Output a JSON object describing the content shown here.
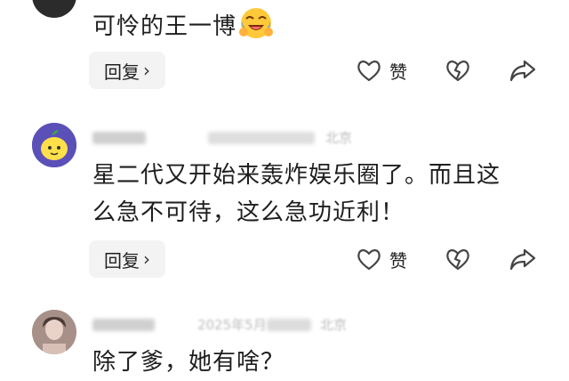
{
  "comments": [
    {
      "text": "可怜的王一博",
      "emoji": "laughing-crying-emoji",
      "reply_label": "回复",
      "like_label": "赞"
    },
    {
      "meta_partial_location": "北京",
      "text": "星二代又开始来轰炸娱乐圈了。而且这么急不可待，这么急功近利！",
      "reply_label": "回复",
      "like_label": "赞"
    },
    {
      "meta_partial_date": "2025年5月",
      "meta_partial_location": "北京",
      "text": "除了爹，她有啥？"
    }
  ],
  "icons": {
    "reply_chevron": "chevron-right-icon",
    "like": "heart-outline-icon",
    "dislike": "broken-heart-icon",
    "share": "share-arrow-icon"
  },
  "colors": {
    "reply_bg": "#f3f3f3",
    "icon": "#444444",
    "text": "#1e1e1e"
  }
}
